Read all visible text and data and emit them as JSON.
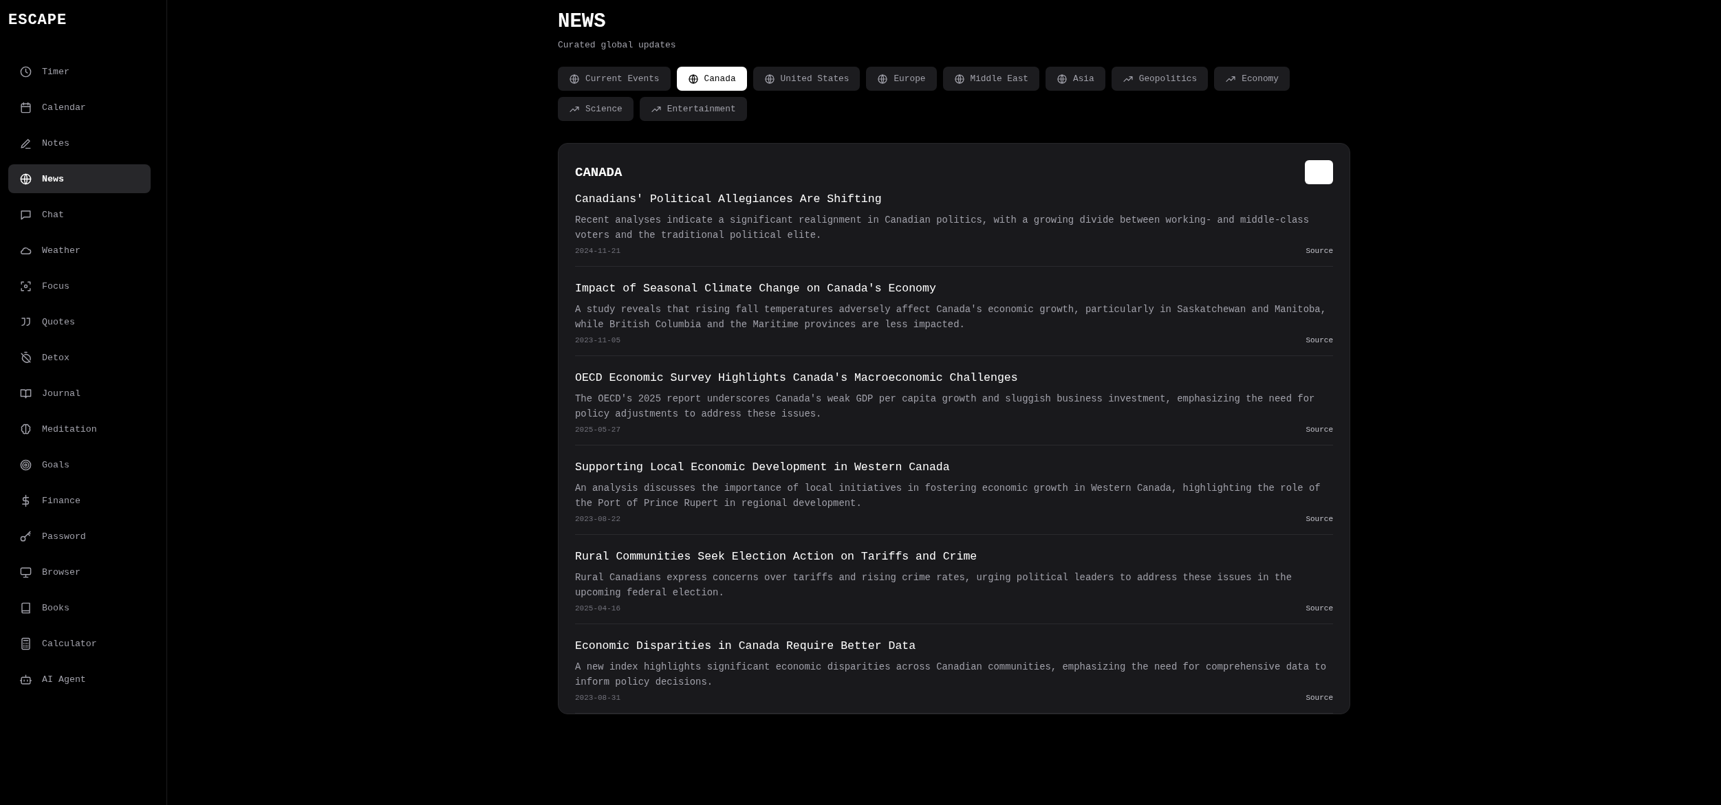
{
  "app": {
    "logo": "ESCAPE"
  },
  "sidebar": {
    "items": [
      {
        "label": "Timer",
        "selected": false
      },
      {
        "label": "Calendar",
        "selected": false
      },
      {
        "label": "Notes",
        "selected": false
      },
      {
        "label": "News",
        "selected": true
      },
      {
        "label": "Chat",
        "selected": false
      },
      {
        "label": "Weather",
        "selected": false
      },
      {
        "label": "Focus",
        "selected": false
      },
      {
        "label": "Quotes",
        "selected": false
      },
      {
        "label": "Detox",
        "selected": false
      },
      {
        "label": "Journal",
        "selected": false
      },
      {
        "label": "Meditation",
        "selected": false
      },
      {
        "label": "Goals",
        "selected": false
      },
      {
        "label": "Finance",
        "selected": false
      },
      {
        "label": "Password",
        "selected": false
      },
      {
        "label": "Browser",
        "selected": false
      },
      {
        "label": "Books",
        "selected": false
      },
      {
        "label": "Calculator",
        "selected": false
      },
      {
        "label": "AI Agent",
        "selected": false
      }
    ]
  },
  "header": {
    "title": "NEWS",
    "subtitle": "Curated global updates"
  },
  "tabs": [
    {
      "label": "Current Events",
      "kind": "region",
      "selected": false
    },
    {
      "label": "Canada",
      "kind": "region",
      "selected": true
    },
    {
      "label": "United States",
      "kind": "region",
      "selected": false
    },
    {
      "label": "Europe",
      "kind": "region",
      "selected": false
    },
    {
      "label": "Middle East",
      "kind": "region",
      "selected": false
    },
    {
      "label": "Asia",
      "kind": "region",
      "selected": false
    },
    {
      "label": "Geopolitics",
      "kind": "topic",
      "selected": false
    },
    {
      "label": "Economy",
      "kind": "topic",
      "selected": false
    },
    {
      "label": "Science",
      "kind": "topic",
      "selected": false
    },
    {
      "label": "Entertainment",
      "kind": "topic",
      "selected": false
    }
  ],
  "feed": {
    "title": "CANADA",
    "articles": [
      {
        "title": "Canadians' Political Allegiances Are Shifting",
        "summary": "Recent analyses indicate a significant realignment in Canadian politics, with a growing divide between working- and middle-class voters and the traditional political elite.",
        "date": "2024-11-21",
        "link": "Source"
      },
      {
        "title": "Impact of Seasonal Climate Change on Canada's Economy",
        "summary": "A study reveals that rising fall temperatures adversely affect Canada's economic growth, particularly in Saskatchewan and Manitoba, while British Columbia and the Maritime provinces are less impacted.",
        "date": "2023-11-05",
        "link": "Source"
      },
      {
        "title": "OECD Economic Survey Highlights Canada's Macroeconomic Challenges",
        "summary": "The OECD's 2025 report underscores Canada's weak GDP per capita growth and sluggish business investment, emphasizing the need for policy adjustments to address these issues.",
        "date": "2025-05-27",
        "link": "Source"
      },
      {
        "title": "Supporting Local Economic Development in Western Canada",
        "summary": "An analysis discusses the importance of local initiatives in fostering economic growth in Western Canada, highlighting the role of the Port of Prince Rupert in regional development.",
        "date": "2023-08-22",
        "link": "Source"
      },
      {
        "title": "Rural Communities Seek Election Action on Tariffs and Crime",
        "summary": "Rural Canadians express concerns over tariffs and rising crime rates, urging political leaders to address these issues in the upcoming federal election.",
        "date": "2025-04-16",
        "link": "Source"
      },
      {
        "title": "Economic Disparities in Canada Require Better Data",
        "summary": "A new index highlights significant economic disparities across Canadian communities, emphasizing the need for comprehensive data to inform policy decisions.",
        "date": "2023-08-31",
        "link": "Source"
      }
    ]
  }
}
